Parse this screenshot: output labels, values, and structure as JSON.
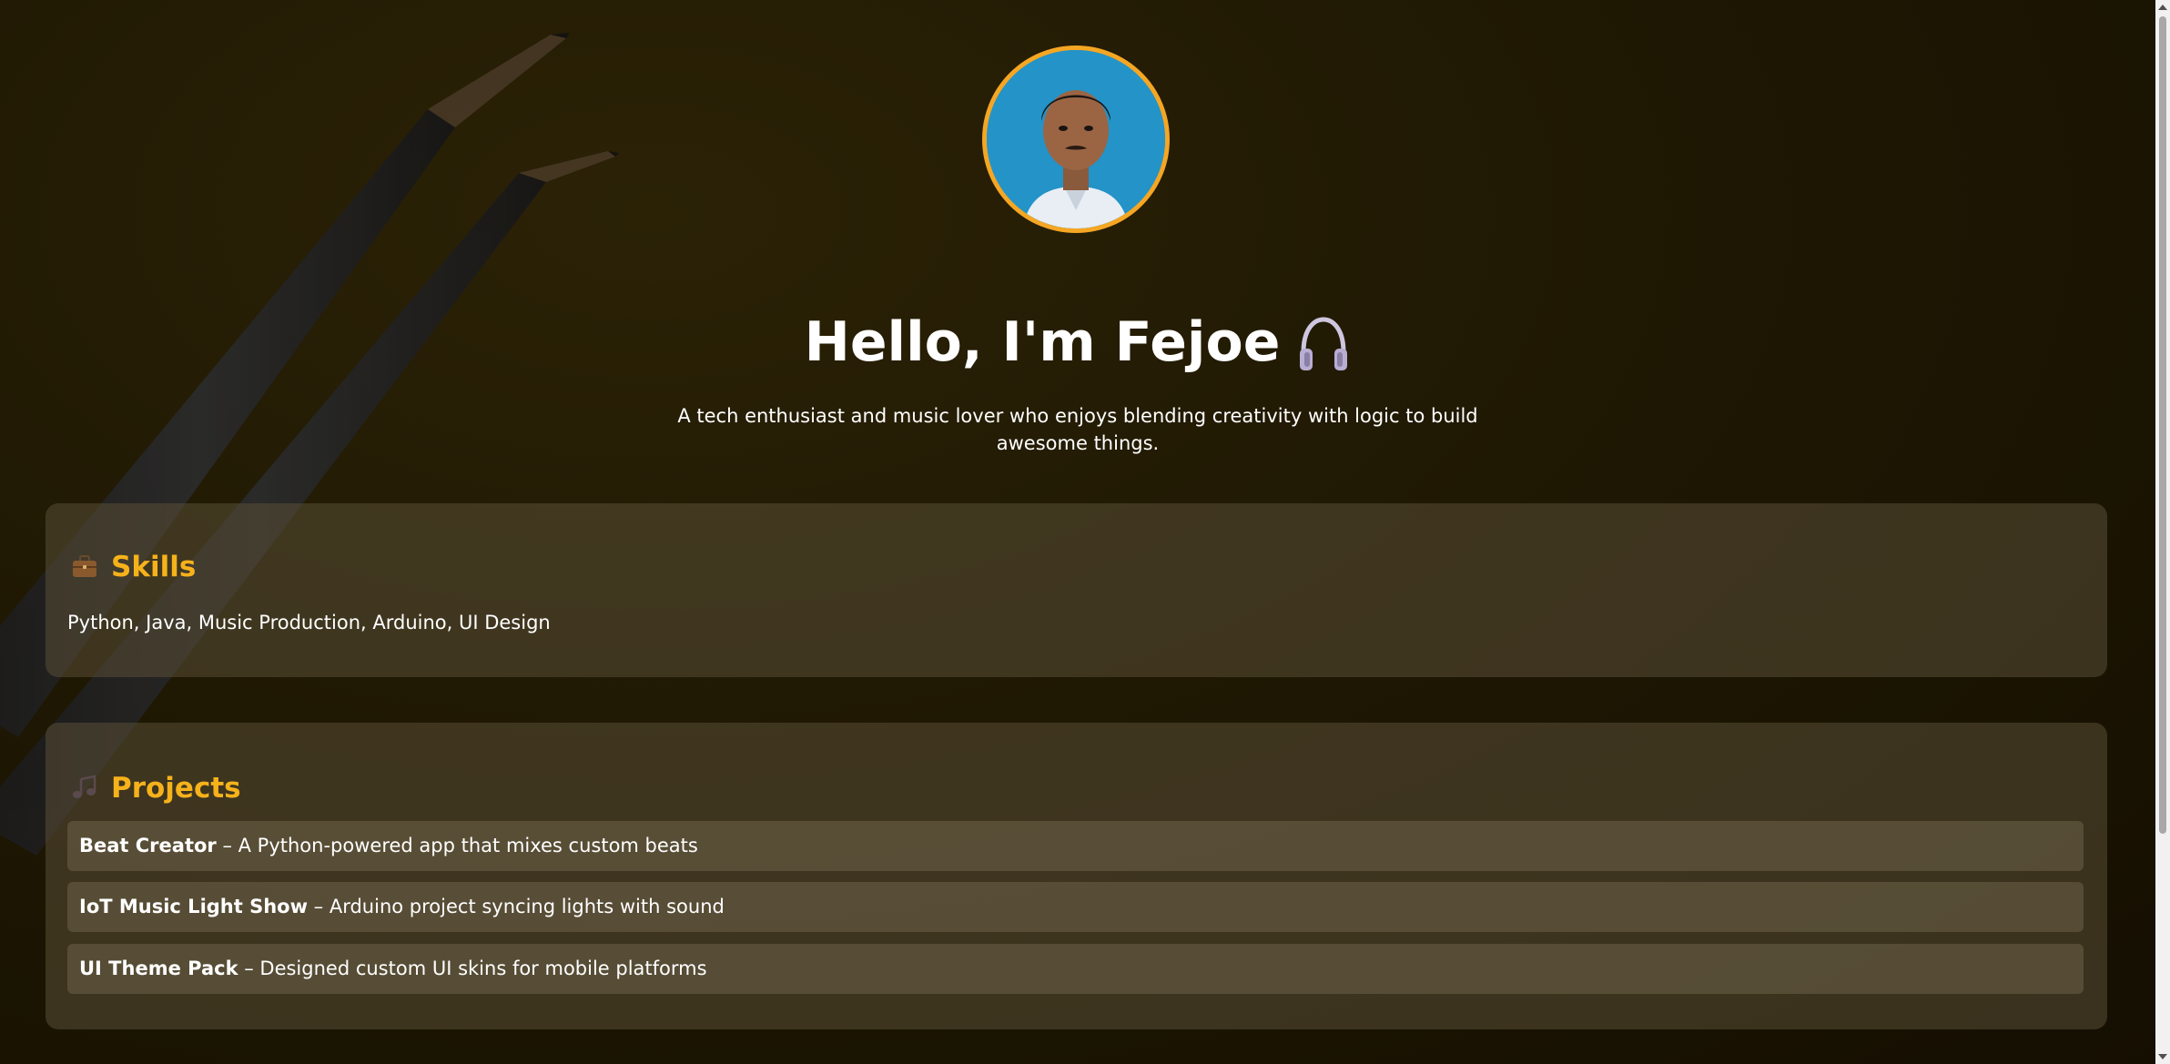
{
  "profile": {
    "avatar_icon": "profile-photo",
    "accent_color": "#f5a623"
  },
  "hero": {
    "title": "Hello, I'm Fejoe",
    "title_icon": "headphones-icon",
    "subtitle": "A tech enthusiast and music lover who enjoys blending creativity with logic to build awesome things."
  },
  "skills": {
    "heading": "Skills",
    "icon": "briefcase-icon",
    "text": "Python, Java, Music Production, Arduino, UI Design"
  },
  "projects": {
    "heading": "Projects",
    "icon": "music-note-icon",
    "items": [
      {
        "name": "Beat Creator",
        "desc": " – A Python-powered app that mixes custom beats"
      },
      {
        "name": "IoT Music Light Show",
        "desc": " – Arduino project syncing lights with sound"
      },
      {
        "name": "UI Theme Pack",
        "desc": " – Designed custom UI skins for mobile platforms"
      }
    ]
  },
  "theme": {
    "heading_color": "#f6b21b",
    "background_color": "#1c1504"
  }
}
